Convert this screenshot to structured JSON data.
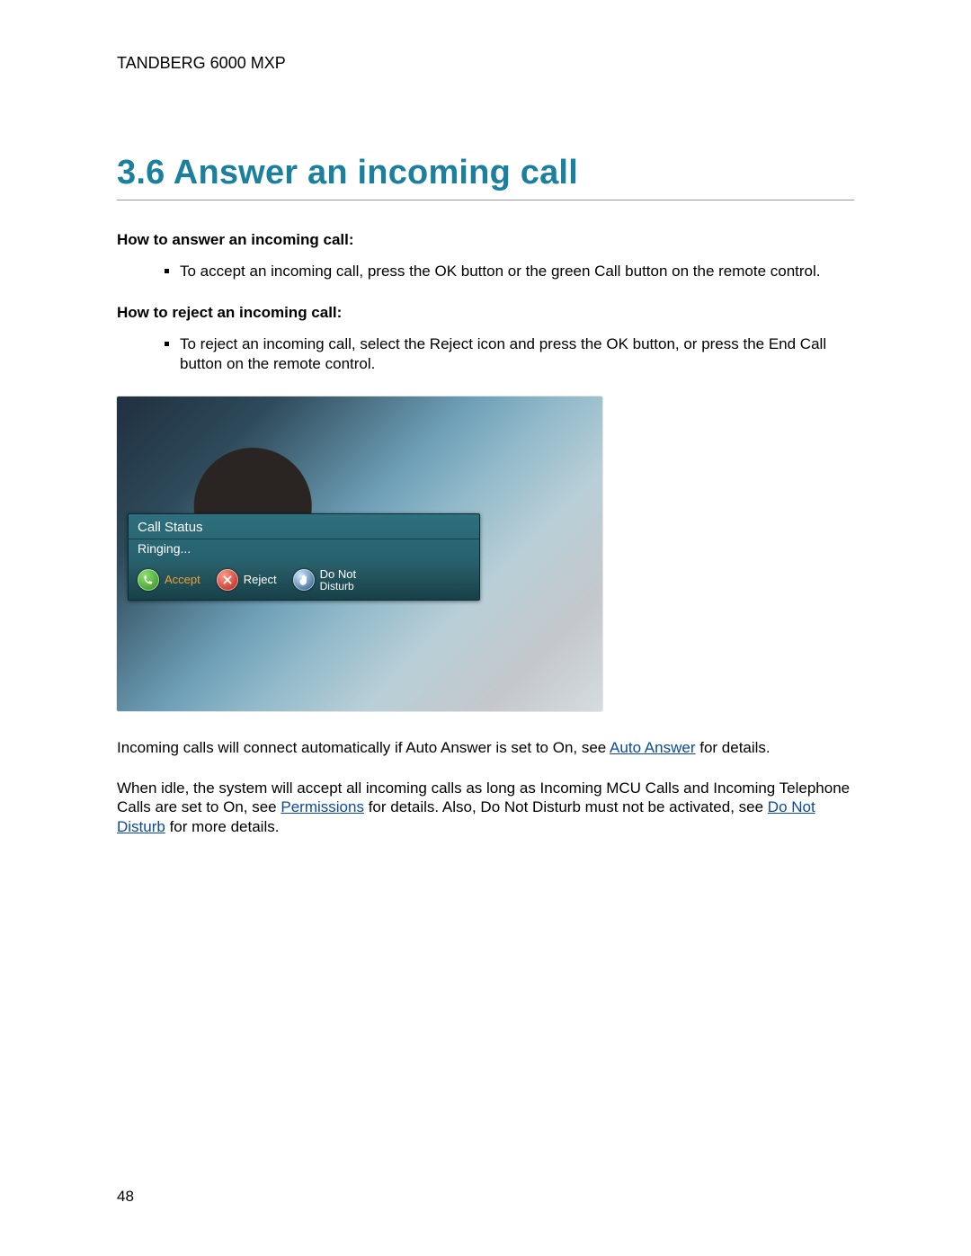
{
  "header": {
    "product": "TANDBERG 6000 MXP"
  },
  "section": {
    "number": "3.6",
    "title": "Answer an incoming call"
  },
  "howto_answer": {
    "heading": "How to answer an incoming call:",
    "items": [
      "To accept an incoming call, press the OK button or the green Call button on the remote control."
    ]
  },
  "howto_reject": {
    "heading": "How to reject an incoming call:",
    "items": [
      "To reject an incoming call, select the Reject icon and press the OK button, or press the End Call button on the remote control."
    ]
  },
  "figure": {
    "panel_title": "Call Status",
    "panel_status": "Ringing...",
    "accept_label": "Accept",
    "reject_label": "Reject",
    "dnd_label_line1": "Do Not",
    "dnd_label_line2": "Disturb"
  },
  "para1": {
    "pre": "Incoming calls will connect automatically if Auto Answer is set to On, see ",
    "link": "Auto Answer",
    "post": " for details."
  },
  "para2": {
    "t1": "When idle, the system will accept all incoming calls as long as Incoming MCU Calls and Incoming Telephone Calls are set to On, see ",
    "link1": "Permissions",
    "t2": " for details. Also, Do Not Disturb must not be activated, see ",
    "link2": "Do Not Disturb",
    "t3": " for more details."
  },
  "page_number": "48"
}
